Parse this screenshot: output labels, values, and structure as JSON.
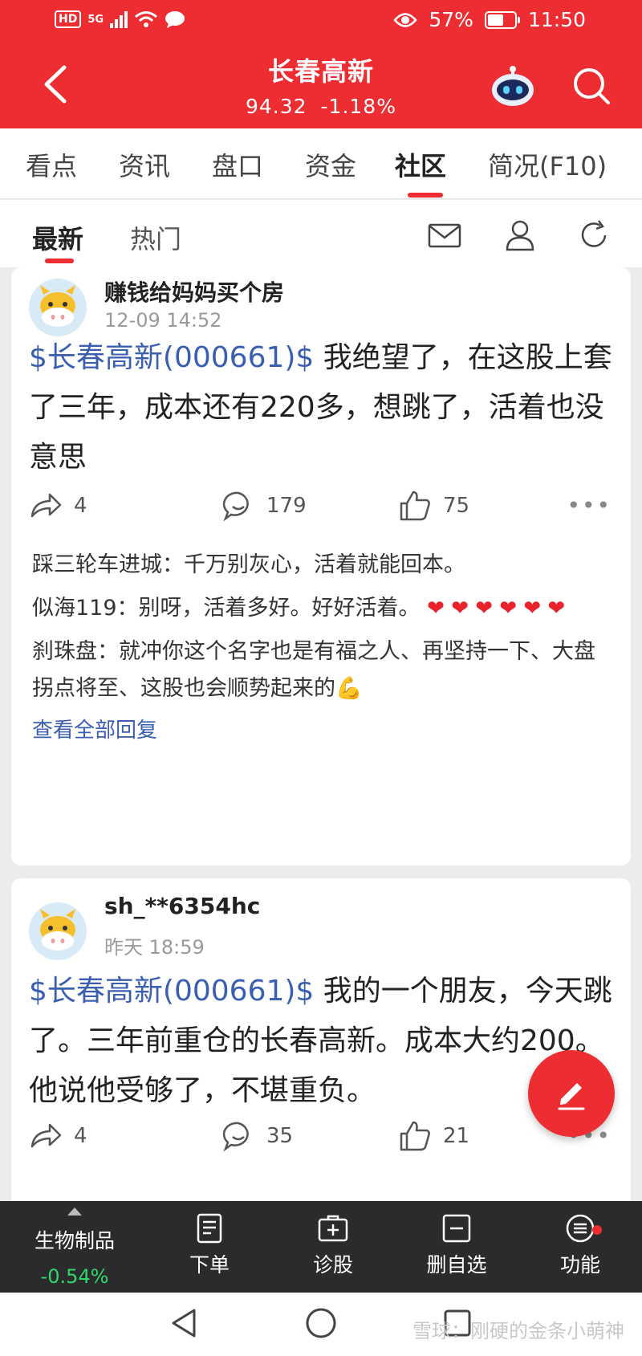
{
  "status_bar": {
    "network_badge": "HD",
    "signal": "5G",
    "battery_percent": "57%",
    "time": "11:50"
  },
  "header": {
    "title": "长春高新",
    "price": "94.32",
    "change": "-1.18%",
    "colors": {
      "brand_red": "#ee2d33"
    }
  },
  "tabs": [
    {
      "label": "看点"
    },
    {
      "label": "资讯"
    },
    {
      "label": "盘口"
    },
    {
      "label": "资金"
    },
    {
      "label": "社区",
      "active": true
    },
    {
      "label": "简况(F10)"
    }
  ],
  "subtabs": [
    {
      "label": "最新",
      "active": true
    },
    {
      "label": "热门"
    }
  ],
  "posts": [
    {
      "username": "赚钱给妈妈买个房",
      "time": "12-09 14:52",
      "stock_tag": "$长春高新(000661)$",
      "text": " 我绝望了，在这股上套了三年，成本还有220多，想跳了，活着也没意思",
      "shares": "4",
      "comments": "179",
      "likes": "75",
      "replies": [
        {
          "author": "踩三轮车进城：",
          "text": "千万别灰心，活着就能回本。"
        },
        {
          "author": "似海119：",
          "text": "别呀，活着多好。好好活着。",
          "hearts": "❤ ❤ ❤ ❤ ❤ ❤"
        },
        {
          "author": "刹珠盘：",
          "text": "就冲你这个名字也是有福之人、再坚持一下、大盘拐点将至、这股也会顺势起来的💪"
        }
      ],
      "view_all": "查看全部回复"
    },
    {
      "username": "sh_**6354hc",
      "time": "昨天 18:59",
      "stock_tag": "$长春高新(000661)$",
      "text": " 我的一个朋友，今天跳了。三年前重仓的长春高新。成本大约200。他说他受够了，不堪重负。",
      "shares": "4",
      "comments": "35",
      "likes": "21"
    }
  ],
  "toolbar": {
    "sector_name": "生物制品",
    "sector_change": "-0.54%",
    "items": [
      {
        "label": "下单",
        "icon": "order-icon"
      },
      {
        "label": "诊股",
        "icon": "diagnose-icon"
      },
      {
        "label": "删自选",
        "icon": "remove-watchlist-icon"
      },
      {
        "label": "功能",
        "icon": "menu-icon"
      }
    ]
  },
  "watermark": "雪球：刚硬的金条小萌神"
}
